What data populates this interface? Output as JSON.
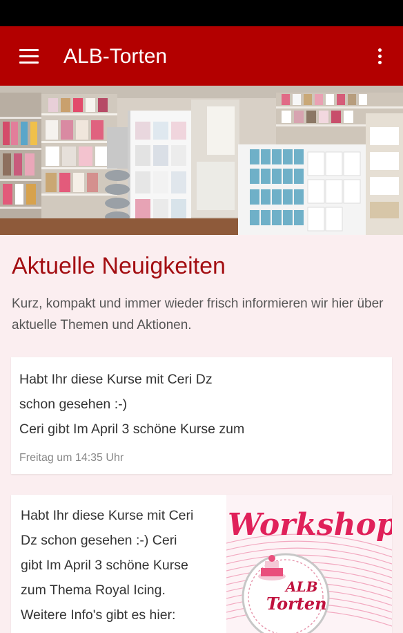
{
  "app": {
    "title": "ALB-Torten",
    "brand_color": "#b30000",
    "menu_icon": "hamburger-menu-icon",
    "overflow_icon": "more-vert-icon"
  },
  "hero": {
    "alt": "Ladengeschäft mit Backzubehör-Regalen"
  },
  "news": {
    "title": "Aktuelle Neuigkeiten",
    "intro": "Kurz, kompakt und immer wieder frisch informieren wir hier über aktuelle Themen und Aktionen.",
    "items": [
      {
        "lines": [
          "Habt Ihr diese Kurse mit Ceri Dz",
          "schon gesehen :-)",
          "Ceri gibt Im April 3 schöne Kurse zum"
        ],
        "date": "Freitag um 14:35 Uhr"
      },
      {
        "lines": [
          "Habt Ihr diese Kurse mit Ceri",
          "Dz schon gesehen :-) Ceri",
          "gibt Im April 3 schöne Kurse",
          "zum Thema Royal Icing.",
          "Weitere Info's gibt es hier:"
        ],
        "image_heading": "Workshops",
        "image_logo_line1": "ALB",
        "image_logo_line2": "Torten"
      }
    ]
  }
}
